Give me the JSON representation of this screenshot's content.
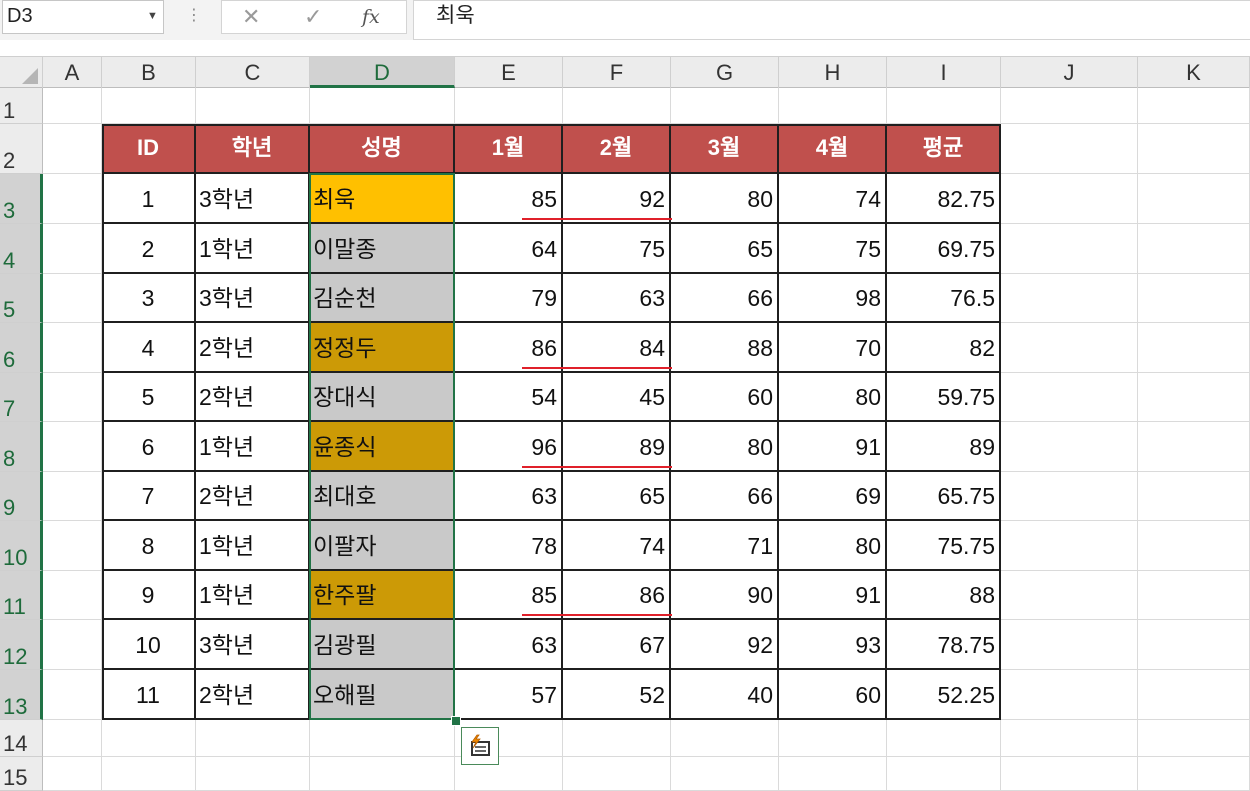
{
  "formula_bar": {
    "name_box": "D3",
    "cancel_icon": "✕",
    "enter_icon": "✓",
    "fx_label": "fx",
    "formula": "최욱"
  },
  "columns": [
    "A",
    "B",
    "C",
    "D",
    "E",
    "F",
    "G",
    "H",
    "I",
    "J",
    "K"
  ],
  "selected_column": "D",
  "rows": [
    "1",
    "2",
    "3",
    "4",
    "5",
    "6",
    "7",
    "8",
    "9",
    "10",
    "11",
    "12",
    "13",
    "14",
    "15"
  ],
  "selected_rows": [
    "3",
    "4",
    "5",
    "6",
    "7",
    "8",
    "9",
    "10",
    "11",
    "12",
    "13"
  ],
  "table": {
    "headers": [
      "ID",
      "학년",
      "성명",
      "1월",
      "2월",
      "3월",
      "4월",
      "평균"
    ],
    "rows": [
      [
        "1",
        "3학년",
        "최욱",
        "85",
        "92",
        "80",
        "74",
        "82.75"
      ],
      [
        "2",
        "1학년",
        "이말종",
        "64",
        "75",
        "65",
        "75",
        "69.75"
      ],
      [
        "3",
        "3학년",
        "김순천",
        "79",
        "63",
        "66",
        "98",
        "76.5"
      ],
      [
        "4",
        "2학년",
        "정정두",
        "86",
        "84",
        "88",
        "70",
        "82"
      ],
      [
        "5",
        "2학년",
        "장대식",
        "54",
        "45",
        "60",
        "80",
        "59.75"
      ],
      [
        "6",
        "1학년",
        "윤종식",
        "96",
        "89",
        "80",
        "91",
        "89"
      ],
      [
        "7",
        "2학년",
        "최대호",
        "63",
        "65",
        "66",
        "69",
        "65.75"
      ],
      [
        "8",
        "1학년",
        "이팔자",
        "78",
        "74",
        "71",
        "80",
        "75.75"
      ],
      [
        "9",
        "1학년",
        "한주팔",
        "85",
        "86",
        "90",
        "91",
        "88"
      ],
      [
        "10",
        "3학년",
        "김광필",
        "63",
        "67",
        "92",
        "93",
        "78.75"
      ],
      [
        "11",
        "2학년",
        "오해필",
        "57",
        "52",
        "40",
        "60",
        "52.25"
      ]
    ],
    "name_fill": [
      "gold",
      "gray",
      "gray",
      "dgold",
      "gray",
      "dgold",
      "gray",
      "gray",
      "dgold",
      "gray",
      "gray"
    ],
    "underlined_rows": [
      0,
      3,
      5,
      8
    ]
  },
  "colors": {
    "header_fill": "#c0504d",
    "highlight_gold": "#ffc000",
    "highlight_dark_gold": "#cc9a06",
    "name_gray": "#c9c9c9",
    "selection_green": "#217346",
    "underline_red": "#e0202a"
  },
  "icons": {
    "name_box_dropdown": "chevron-down-icon",
    "quick_analysis": "quick-analysis-icon"
  }
}
